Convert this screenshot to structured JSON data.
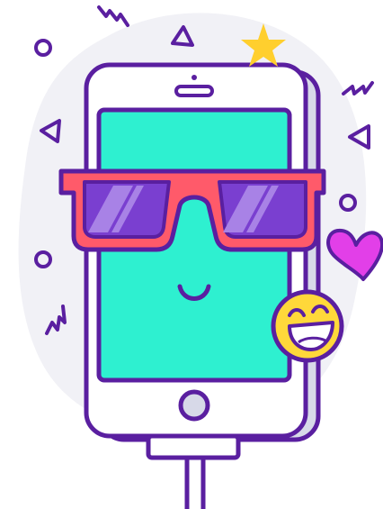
{
  "illustration": {
    "subject": "cool-smartphone-with-sunglasses",
    "decorations": [
      "circle-icon",
      "triangle-icon",
      "squiggle-icon",
      "star-icon",
      "heart-icon",
      "grinning-emoji-icon"
    ]
  },
  "colors": {
    "outline": "#5a1fa0",
    "screen": "#2ef0d0",
    "phone_body": "#ffffff",
    "phone_side": "#d7d9e8",
    "backdrop": "#f1f1f6",
    "glasses_frame": "#ff5a6a",
    "glasses_lens": "#7a3fd0",
    "lens_shine": "#a882e6",
    "star": "#ffcf2e",
    "heart": "#e23fe8",
    "emoji_face": "#ffd83a",
    "cable_plug": "#ffffff"
  }
}
